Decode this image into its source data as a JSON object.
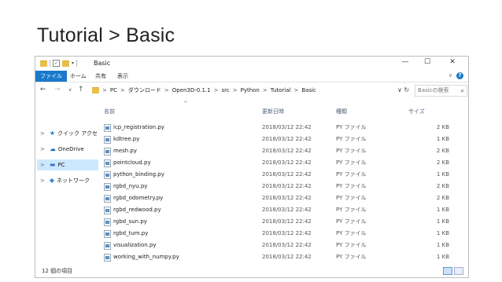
{
  "slide": {
    "title": "Tutorial > Basic"
  },
  "window": {
    "title": "Basic",
    "controls": {
      "minimize": "—",
      "maximize": "☐",
      "close": "✕"
    },
    "ribbon_tabs": [
      "ファイル",
      "ホーム",
      "共有",
      "表示"
    ],
    "help_icon": "?",
    "ribbon_expand": "∨"
  },
  "address": {
    "back": "←",
    "forward": "→",
    "recent": "∨",
    "up": "↑",
    "crumbs": [
      "PC",
      "ダウンロード",
      "Open3D-0.1.1",
      "src",
      "Python",
      "Tutorial",
      "Basic"
    ],
    "dropdown": "∨",
    "refresh": "↻",
    "search_placeholder": "Basicの検索",
    "search_icon": "⌕"
  },
  "nav": {
    "items": [
      {
        "label": "クイック アクセ",
        "icon": "star-icon",
        "glyph": "★",
        "color": "#1979ca"
      },
      {
        "label": "OneDrive",
        "icon": "cloud-icon",
        "glyph": "☁",
        "color": "#1a6fc4"
      },
      {
        "label": "PC",
        "icon": "pc-icon",
        "glyph": "▬",
        "color": "#3b78c4",
        "selected": true
      },
      {
        "label": "ネットワーク",
        "icon": "network-icon",
        "glyph": "◆",
        "color": "#3a8ad6"
      }
    ]
  },
  "columns": {
    "name": "名前",
    "date": "更新日時",
    "type": "種類",
    "size": "サイズ"
  },
  "files": [
    {
      "name": "icp_registration.py",
      "date": "2018/03/12 22:42",
      "type": "PY ファイル",
      "size": "2 KB"
    },
    {
      "name": "kdtree.py",
      "date": "2018/03/12 22:42",
      "type": "PY ファイル",
      "size": "1 KB"
    },
    {
      "name": "mesh.py",
      "date": "2018/03/12 22:42",
      "type": "PY ファイル",
      "size": "2 KB"
    },
    {
      "name": "pointcloud.py",
      "date": "2018/03/12 22:42",
      "type": "PY ファイル",
      "size": "2 KB"
    },
    {
      "name": "python_binding.py",
      "date": "2018/03/12 22:42",
      "type": "PY ファイル",
      "size": "1 KB"
    },
    {
      "name": "rgbd_nyu.py",
      "date": "2018/03/12 22:42",
      "type": "PY ファイル",
      "size": "2 KB"
    },
    {
      "name": "rgbd_odometry.py",
      "date": "2018/03/12 22:42",
      "type": "PY ファイル",
      "size": "2 KB"
    },
    {
      "name": "rgbd_redwood.py",
      "date": "2018/03/12 22:42",
      "type": "PY ファイル",
      "size": "1 KB"
    },
    {
      "name": "rgbd_sun.py",
      "date": "2018/03/12 22:42",
      "type": "PY ファイル",
      "size": "1 KB"
    },
    {
      "name": "rgbd_tum.py",
      "date": "2018/03/12 22:42",
      "type": "PY ファイル",
      "size": "1 KB"
    },
    {
      "name": "visualization.py",
      "date": "2018/03/12 22:42",
      "type": "PY ファイル",
      "size": "1 KB"
    },
    {
      "name": "working_with_numpy.py",
      "date": "2018/03/12 22:42",
      "type": "PY ファイル",
      "size": "1 KB"
    }
  ],
  "status": {
    "count": "12 個の項目"
  }
}
